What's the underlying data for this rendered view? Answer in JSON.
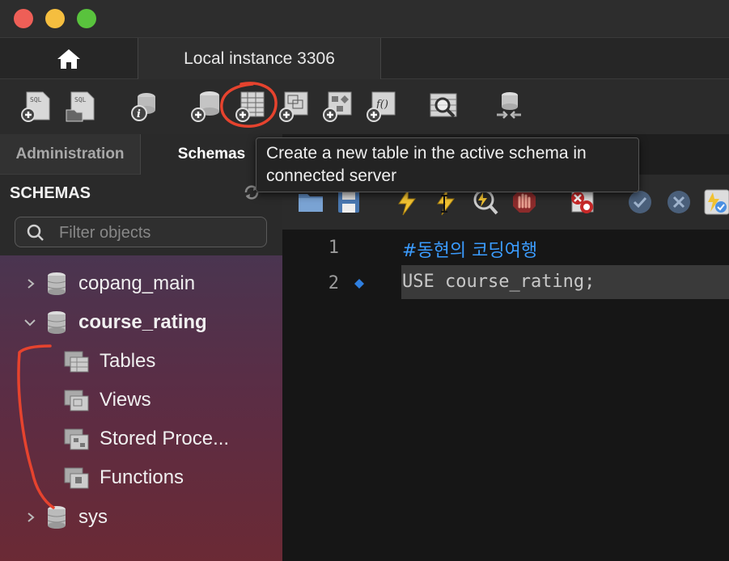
{
  "window": {
    "traffic_lights": {
      "close": "#ee5f57",
      "minimize": "#f5be3f",
      "zoom": "#59c33d"
    }
  },
  "tabs": {
    "home_icon": "home-icon",
    "connection_label": "Local instance 3306"
  },
  "toolbar": {
    "icons": [
      "new-sql-tab-icon",
      "open-sql-script-icon",
      "inspector-icon",
      "create-schema-icon",
      "create-table-icon",
      "create-view-icon",
      "create-procedure-icon",
      "create-function-icon",
      "search-table-data-icon",
      "reconnect-icon"
    ]
  },
  "tooltip": {
    "line1": "Create a new table in the active schema in",
    "line2": "connected server"
  },
  "sidebar": {
    "tabs": [
      "Administration",
      "Schemas"
    ],
    "title": "SCHEMAS",
    "filter_placeholder": "Filter objects",
    "schemas": [
      {
        "name": "copang_main",
        "expanded": false
      },
      {
        "name": "course_rating",
        "expanded": true,
        "children": [
          "Tables",
          "Views",
          "Stored Proce...",
          "Functions"
        ]
      },
      {
        "name": "sys",
        "expanded": false
      }
    ]
  },
  "editor": {
    "lines": [
      {
        "num": "1",
        "text": "#동현의 코딩여행"
      },
      {
        "num": "2",
        "text": "USE course_rating;"
      }
    ],
    "keyword_color": "#c8c8c8",
    "comment_color": "#3b9cff"
  }
}
